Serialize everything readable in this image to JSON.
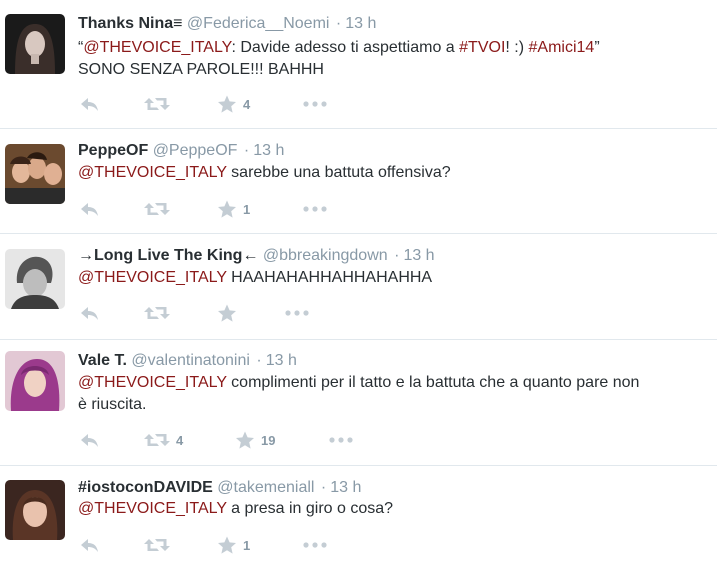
{
  "icons": {
    "reply": "reply-icon",
    "retweet": "retweet-icon",
    "favorite": "star-icon",
    "more": "more-dots-icon"
  },
  "colors": {
    "link": "#8b1a1a",
    "muted": "#8899a6",
    "action": "#c4cdd4",
    "divider": "#e1e8ed"
  },
  "tweets": [
    {
      "fullname": "Thanks Nina≡",
      "screen_name": "@Federica__Noemi",
      "separator": "·",
      "time": "13 h",
      "text": [
        "“",
        "@THEVOICE_ITALY",
        ": Davide adesso ti aspettiamo a ",
        "#TVOI",
        "! :) ",
        "#Amici14",
        "”",
        "SONO SENZA PAROLE!!! BAHHH"
      ],
      "retweets": "",
      "favorites": "4"
    },
    {
      "fullname": "PeppeOF",
      "screen_name": "@PeppeOF",
      "separator": "·",
      "time": "13 h",
      "text": [
        "@THEVOICE_ITALY",
        " sarebbe una battuta offensiva?"
      ],
      "retweets": "",
      "favorites": "1"
    },
    {
      "fullname": "→Long Live The King←",
      "screen_name": "@bbreakingdown",
      "separator": "·",
      "time": "13 h",
      "text": [
        "@THEVOICE_ITALY",
        " HAAHAHAHHAHHAHAHHA"
      ],
      "retweets": "",
      "favorites": ""
    },
    {
      "fullname": "Vale T.",
      "screen_name": "@valentinatonini",
      "separator": "·",
      "time": "13 h",
      "text": [
        "@THEVOICE_ITALY",
        " complimenti per il tatto e la battuta che a quanto pare non",
        "è riuscita."
      ],
      "retweets": "4",
      "favorites": "19"
    },
    {
      "fullname": "#iostoconDAVIDE",
      "screen_name": "@takemeniall",
      "separator": "·",
      "time": "13 h",
      "text": [
        "@THEVOICE_ITALY",
        " a presa in giro o cosa?"
      ],
      "retweets": "",
      "favorites": "1"
    }
  ]
}
